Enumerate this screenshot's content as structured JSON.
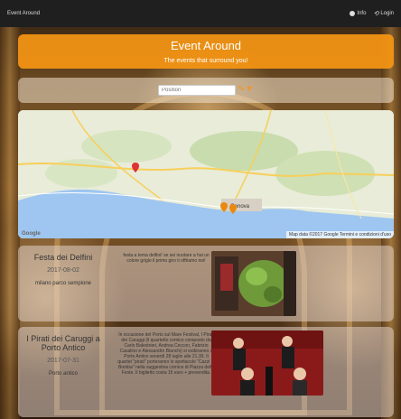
{
  "app": {
    "brand": "Event Around"
  },
  "topnav": {
    "info_label": "Info",
    "login_label": "Login"
  },
  "header": {
    "title": "Event Around",
    "subtitle": "The events that surround you!"
  },
  "search": {
    "placeholder": "Position",
    "value": "",
    "filter_icon": "filter-icon",
    "edit_icon": "pencil-icon"
  },
  "map": {
    "attribution": "Map data ©2017 Google  Termini e condizioni d'uso",
    "logo": "Google",
    "city_label": "Genova",
    "marker_count": 3
  },
  "events": [
    {
      "name": "Festa dei Delfini",
      "date": "2017-08-02",
      "place": "milano parco sempione",
      "description": "festa a tema delfini! se sei nuotare a hai un colore grigio il primo giro ti offriamo noi!"
    },
    {
      "name": "I Pirati dei Caruggi a Porto Antico",
      "date": "2017-07-31",
      "place": "Porto antico",
      "description": "In occasione del Porto sul Mare Festival, I Pirati dei Caruggi (il quartetto comico composto da Carlo Balestrieri, Andrea Ceccon, Fabrizio Casalino e Alessandro Bianchi) si esibiranno a Porto Antico venerdì 28 luglio alle 21.30. Il quartet \"pirati\" porteranno lo spettacolo \"Cazzi le Bomba\" nella suggestiva cornice di Piazza delle Feste. Il biglietto costa 15 euro + prevendita."
    }
  ]
}
